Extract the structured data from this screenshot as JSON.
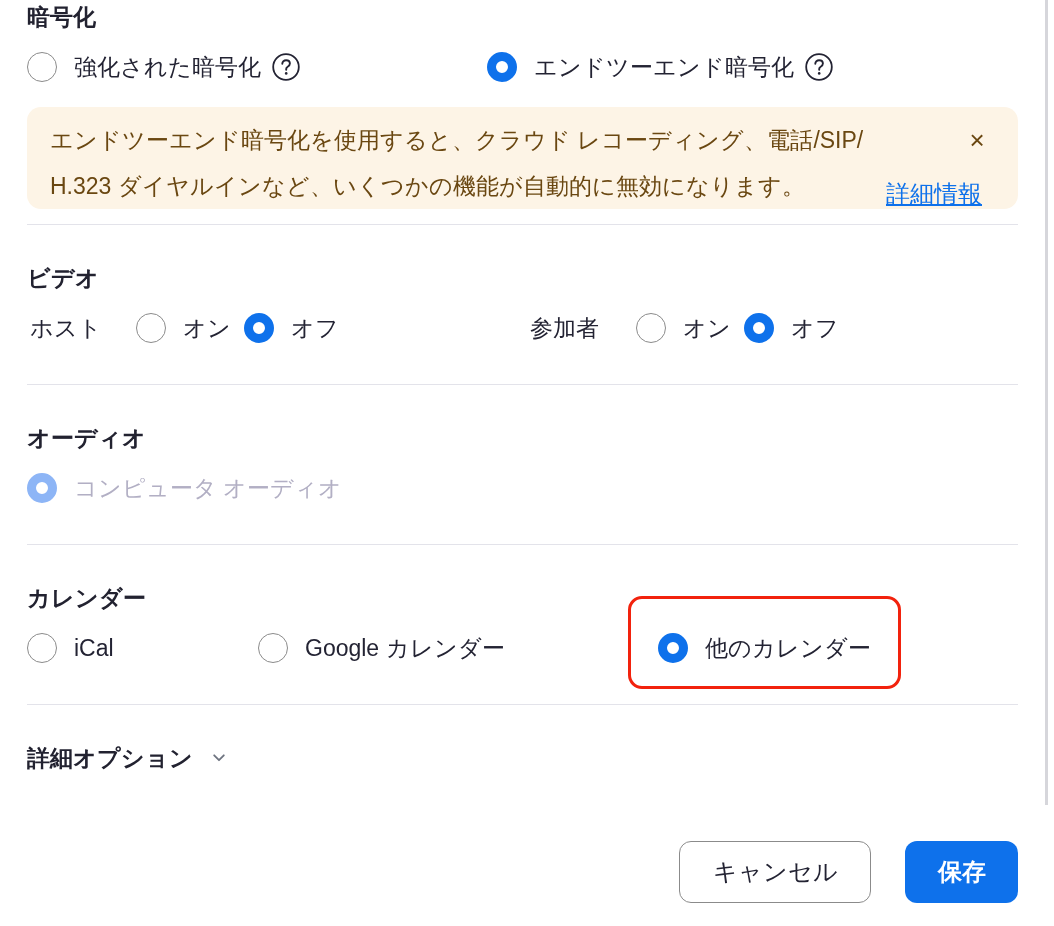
{
  "encryption": {
    "title": "暗号化",
    "options": [
      {
        "label": "強化された暗号化",
        "selected": false,
        "help": true
      },
      {
        "label": "エンドツーエンド暗号化",
        "selected": true,
        "help": true
      }
    ],
    "notice": {
      "text": "エンドツーエンド暗号化を使用すると、クラウド レコーディング、電話/SIP/H.323 ダイヤルインなど、いくつかの機能が自動的に無効になります。",
      "link": "詳細情報",
      "close": "×"
    }
  },
  "video": {
    "title": "ビデオ",
    "groups": [
      {
        "label": "ホスト",
        "options": [
          {
            "label": "オン",
            "selected": false
          },
          {
            "label": "オフ",
            "selected": true
          }
        ]
      },
      {
        "label": "参加者",
        "options": [
          {
            "label": "オン",
            "selected": false
          },
          {
            "label": "オフ",
            "selected": true
          }
        ]
      }
    ]
  },
  "audio": {
    "title": "オーディオ",
    "options": [
      {
        "label": "コンピュータ オーディオ",
        "selected": true,
        "disabled": true
      }
    ]
  },
  "calendar": {
    "title": "カレンダー",
    "options": [
      {
        "label": "iCal",
        "selected": false,
        "highlighted": false
      },
      {
        "label": "Google カレンダー",
        "selected": false,
        "highlighted": false
      },
      {
        "label": "他のカレンダー",
        "selected": true,
        "highlighted": true
      }
    ]
  },
  "advanced_options": {
    "label": "詳細オプション",
    "expanded": false
  },
  "buttons": [
    {
      "label": "キャンセル",
      "kind": "secondary"
    },
    {
      "label": "保存",
      "kind": "primary"
    }
  ]
}
